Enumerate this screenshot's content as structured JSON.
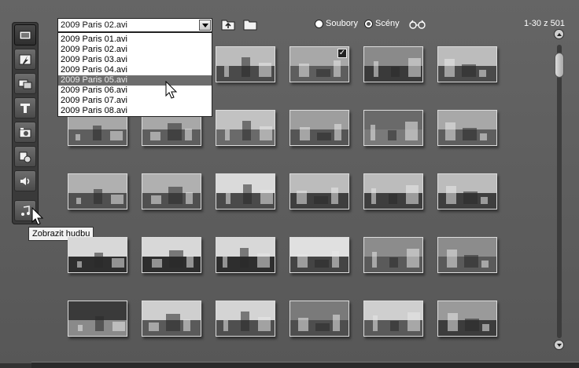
{
  "toolbar": {
    "tools": [
      {
        "name": "video-tool-button",
        "icon": "video-icon",
        "active": true
      },
      {
        "name": "transition-tool-button",
        "icon": "transition-icon",
        "active": false
      },
      {
        "name": "overlay-tool-button",
        "icon": "overlay-icon",
        "active": false
      },
      {
        "name": "title-tool-button",
        "icon": "title-icon",
        "active": false
      },
      {
        "name": "photo-tool-button",
        "icon": "camera-icon",
        "active": false
      },
      {
        "name": "menu-tool-button",
        "icon": "disc-menu-icon",
        "active": false
      },
      {
        "name": "sound-tool-button",
        "icon": "speaker-icon",
        "active": false
      },
      {
        "name": "music-tool-button",
        "icon": "music-note-icon",
        "active": false
      }
    ],
    "tooltip": "Zobrazit hudbu"
  },
  "file_select": {
    "value": "2009 Paris 02.avi",
    "options": [
      "2009 Paris 01.avi",
      "2009 Paris 02.avi",
      "2009 Paris 03.avi",
      "2009 Paris 04.avi",
      "2009 Paris 05.avi",
      "2009 Paris 06.avi",
      "2009 Paris 07.avi",
      "2009 Paris 08.avi"
    ],
    "highlighted_index": 4
  },
  "view_mode": {
    "files_label": "Soubory",
    "scenes_label": "Scény",
    "selected": "scenes"
  },
  "icons": {
    "up_folder": "folder-up-icon",
    "folder": "folder-icon",
    "preview": "glasses-icon"
  },
  "counter": "1-30 z 501",
  "scenes": [
    {
      "tone": "street",
      "checked": false
    },
    {
      "tone": "street",
      "checked": false
    },
    {
      "tone": "street",
      "checked": false
    },
    {
      "tone": "plaza",
      "checked": true
    },
    {
      "tone": "sun",
      "checked": false
    },
    {
      "tone": "street",
      "checked": false
    },
    {
      "tone": "plaza",
      "checked": false
    },
    {
      "tone": "plaza",
      "checked": false
    },
    {
      "tone": "avenue",
      "checked": false
    },
    {
      "tone": "people",
      "checked": false
    },
    {
      "tone": "aerial",
      "checked": false
    },
    {
      "tone": "plaza",
      "checked": false
    },
    {
      "tone": "building",
      "checked": false
    },
    {
      "tone": "building",
      "checked": false
    },
    {
      "tone": "sunburst",
      "checked": false
    },
    {
      "tone": "fountain",
      "checked": false
    },
    {
      "tone": "fountain",
      "checked": false
    },
    {
      "tone": "fountain",
      "checked": false
    },
    {
      "tone": "fountain-close",
      "checked": false
    },
    {
      "tone": "fountain-close",
      "checked": false
    },
    {
      "tone": "fountain-close",
      "checked": false
    },
    {
      "tone": "car",
      "checked": false
    },
    {
      "tone": "water",
      "checked": false
    },
    {
      "tone": "water",
      "checked": false
    },
    {
      "tone": "dark-water",
      "checked": false
    },
    {
      "tone": "statue",
      "checked": false
    },
    {
      "tone": "crowd",
      "checked": false
    },
    {
      "tone": "sign",
      "checked": false
    },
    {
      "tone": "statue",
      "checked": false
    },
    {
      "tone": "street-dark",
      "checked": false
    }
  ]
}
